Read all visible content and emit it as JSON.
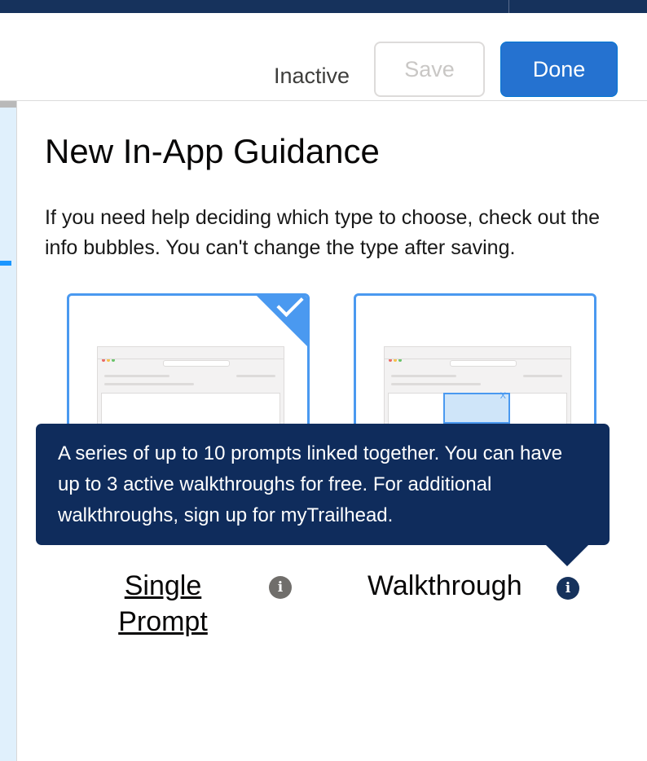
{
  "header": {
    "status": "Inactive",
    "save_label": "Save",
    "done_label": "Done"
  },
  "main": {
    "title": "New In-App Guidance",
    "description": "If you need help deciding which type to choose, check out the info bubbles. You can't change the type after saving."
  },
  "types": {
    "single": {
      "label": "Single Prompt",
      "selected": true,
      "info_icon": "info-icon"
    },
    "walkthrough": {
      "label": "Walkthrough",
      "selected": false,
      "info_icon": "info-icon"
    }
  },
  "tooltip": {
    "text": "A series of up to 10 prompts linked together. You can have up to 3 active walkthroughs for free. For additional walkthroughs, sign up for myTrailhead."
  },
  "icons": {
    "check": "check-icon",
    "info": "info-icon",
    "close_in_preview": "X"
  },
  "colors": {
    "accent": "#2572d0",
    "selection": "#4a99f0",
    "tooltip_bg": "#0f2c5c",
    "topbar": "#16325c"
  }
}
